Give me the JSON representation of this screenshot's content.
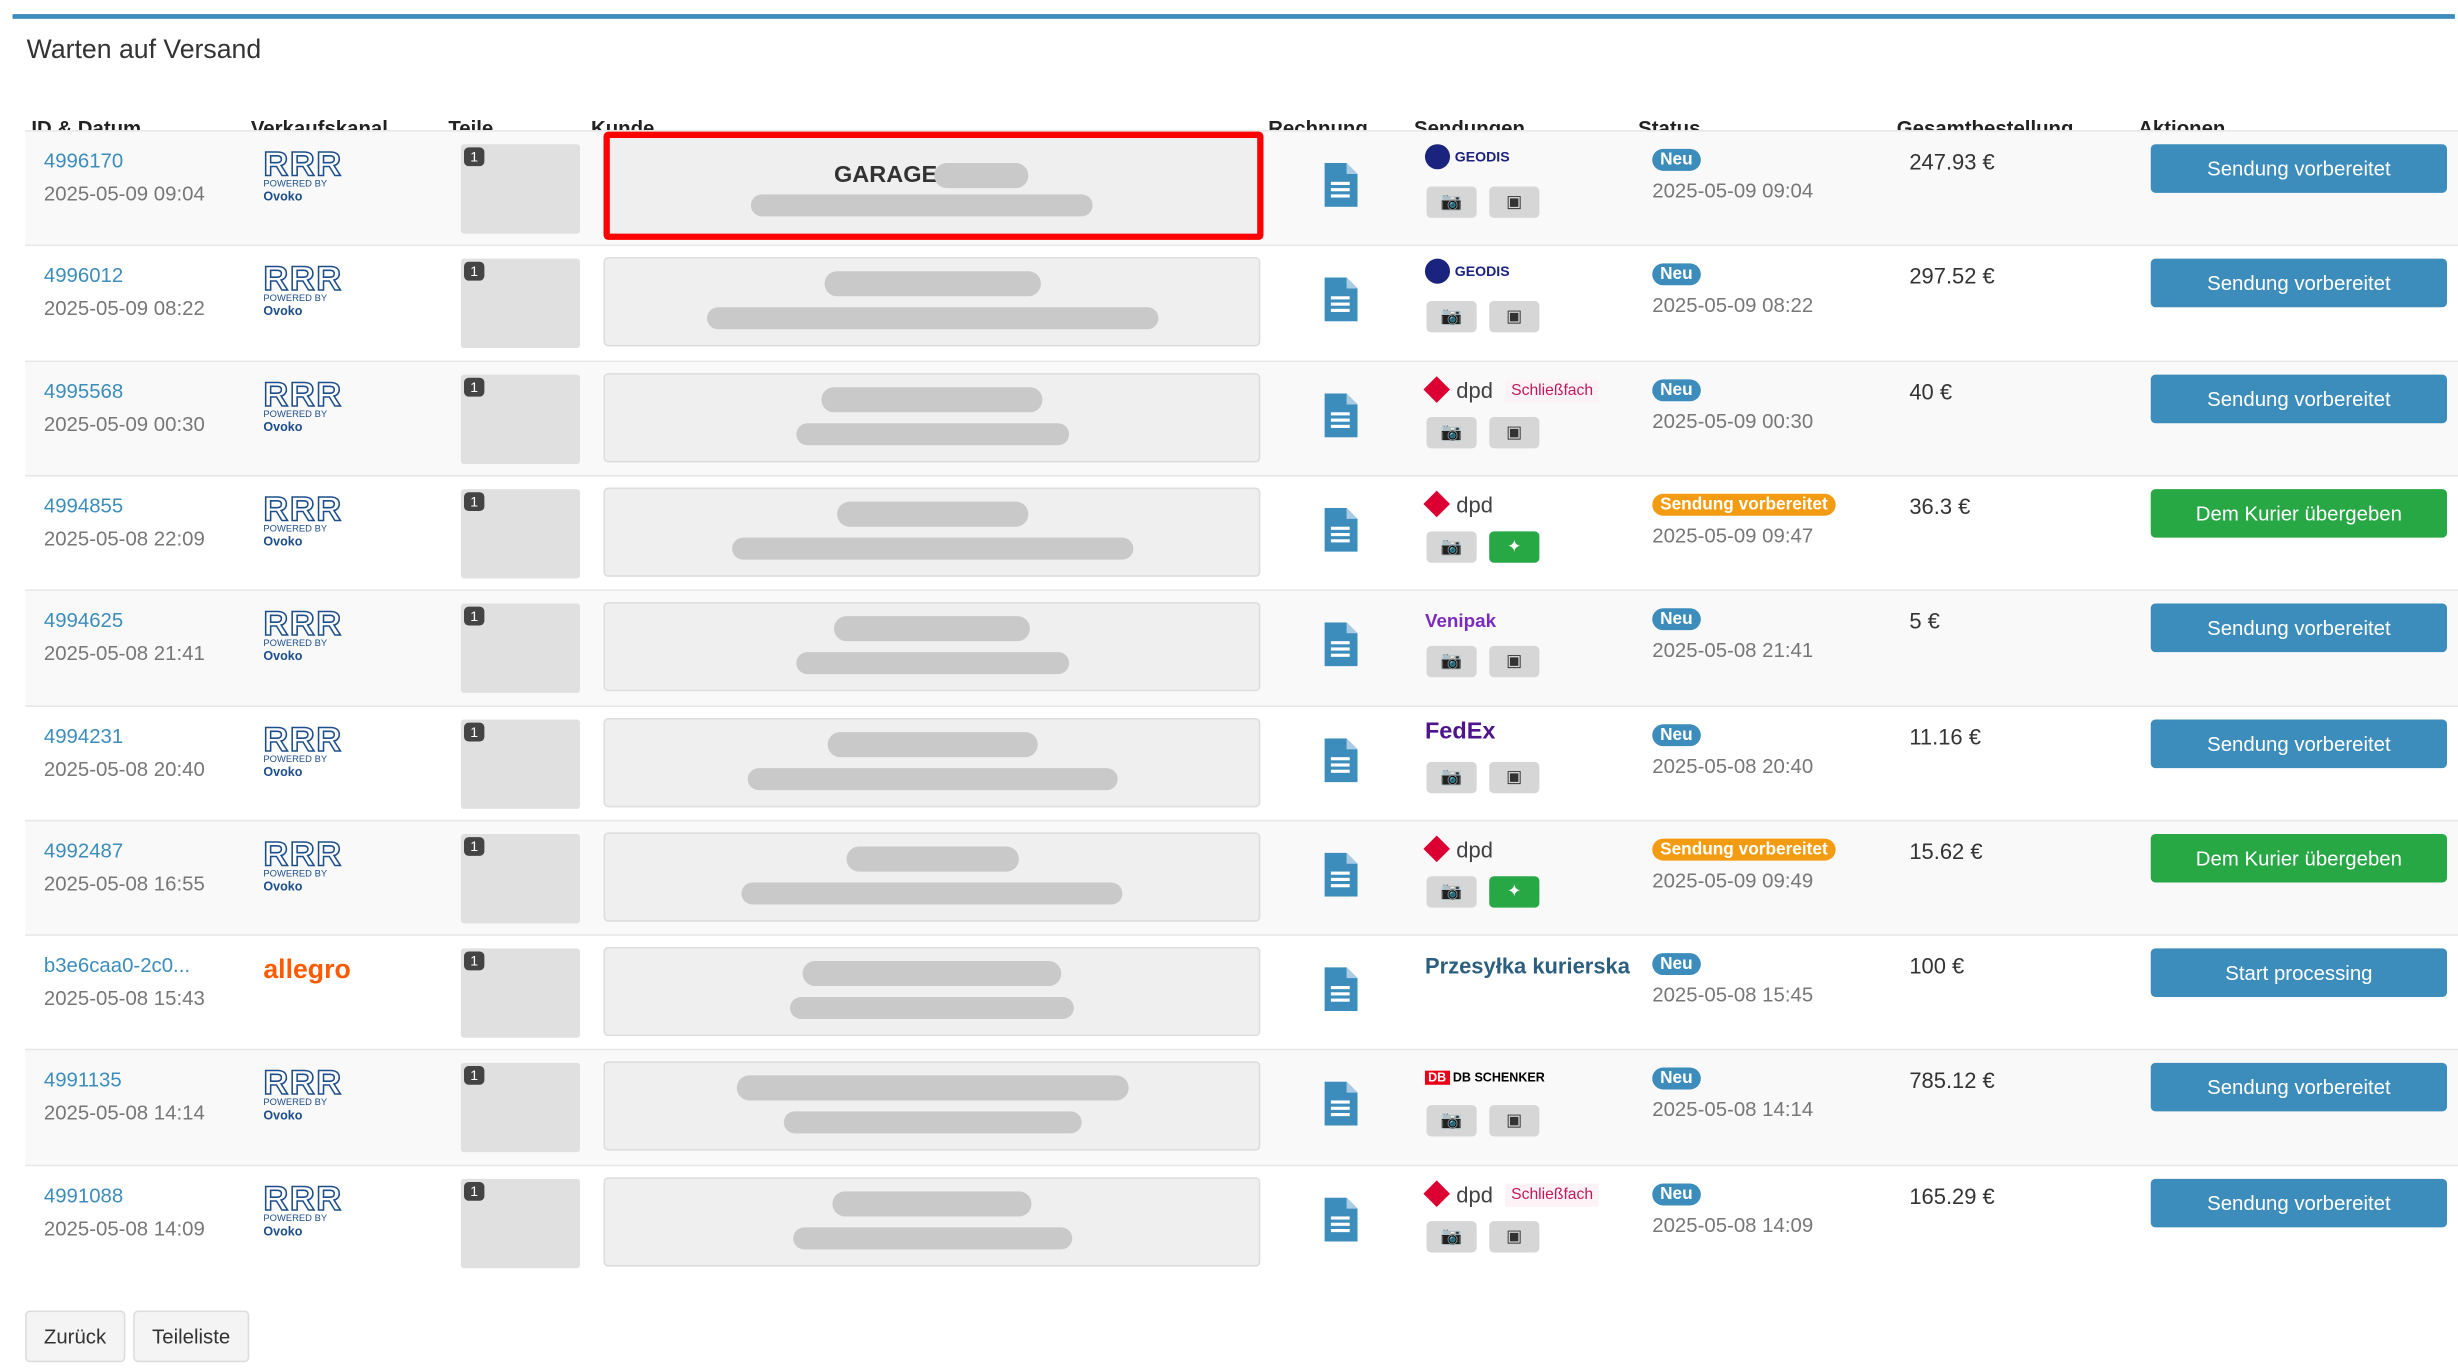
{
  "panel": {
    "title": "Warten auf Versand"
  },
  "headers": {
    "id_date": "ID & Datum",
    "channel": "Verkaufskanal",
    "parts": "Teile",
    "customer": "Kunde",
    "invoice": "Rechnung",
    "shipments": "Sendungen",
    "status": "Status",
    "total": "Gesamtbestellung",
    "actions": "Aktionen"
  },
  "rows": [
    {
      "id": "4996170",
      "date": "2025-05-09 09:04",
      "channel": "RRR",
      "qty": "1",
      "customer": "GARAGE",
      "carrier": "GEODIS",
      "carrier_tag": "",
      "status": "Neu",
      "status_date": "2025-05-09 09:04",
      "total": "247.93 €",
      "action": "Sendung vorbereitet",
      "action_color": "#3c8dbc"
    },
    {
      "id": "4996012",
      "date": "2025-05-09 08:22",
      "channel": "RRR",
      "qty": "1",
      "customer": "",
      "carrier": "GEODIS",
      "carrier_tag": "",
      "status": "Neu",
      "status_date": "2025-05-09 08:22",
      "total": "297.52 €",
      "action": "Sendung vorbereitet",
      "action_color": "#3c8dbc"
    },
    {
      "id": "4995568",
      "date": "2025-05-09 00:30",
      "channel": "RRR",
      "qty": "1",
      "customer": "",
      "carrier": "dpd",
      "carrier_tag": "Schließfach",
      "status": "Neu",
      "status_date": "2025-05-09 00:30",
      "total": "40 €",
      "action": "Sendung vorbereitet",
      "action_color": "#3c8dbc"
    },
    {
      "id": "4994855",
      "date": "2025-05-08 22:09",
      "channel": "RRR",
      "qty": "1",
      "customer": "",
      "carrier": "dpd",
      "carrier_tag": "",
      "status": "Sendung vorbereitet",
      "status_date": "2025-05-09 09:47",
      "total": "36.3 €",
      "action": "Dem Kurier übergeben",
      "action_color": "#28a745"
    },
    {
      "id": "4994625",
      "date": "2025-05-08 21:41",
      "channel": "RRR",
      "qty": "1",
      "customer": "",
      "carrier": "Venipak",
      "carrier_tag": "",
      "status": "Neu",
      "status_date": "2025-05-08 21:41",
      "total": "5 €",
      "action": "Sendung vorbereitet",
      "action_color": "#3c8dbc"
    },
    {
      "id": "4994231",
      "date": "2025-05-08 20:40",
      "channel": "RRR",
      "qty": "1",
      "customer": "",
      "carrier": "FedEx",
      "carrier_tag": "",
      "status": "Neu",
      "status_date": "2025-05-08 20:40",
      "total": "11.16 €",
      "action": "Sendung vorbereitet",
      "action_color": "#3c8dbc"
    },
    {
      "id": "4992487",
      "date": "2025-05-08 16:55",
      "channel": "RRR",
      "qty": "1",
      "customer": "",
      "carrier": "dpd",
      "carrier_tag": "",
      "status": "Sendung vorbereitet",
      "status_date": "2025-05-09 09:49",
      "total": "15.62 €",
      "action": "Dem Kurier übergeben",
      "action_color": "#28a745"
    },
    {
      "id": "b3e6caa0-2c0...",
      "date": "2025-05-08 15:43",
      "channel": "allegro",
      "qty": "1",
      "customer": "",
      "carrier": "Przesyłka kurierska",
      "carrier_tag": "",
      "status": "Neu",
      "status_date": "2025-05-08 15:45",
      "total": "100 €",
      "action": "Start processing",
      "action_color": "#3c8dbc"
    },
    {
      "id": "4991135",
      "date": "2025-05-08 14:14",
      "channel": "RRR",
      "qty": "1",
      "customer": "",
      "carrier": "DB SCHENKER",
      "carrier_tag": "",
      "status": "Neu",
      "status_date": "2025-05-08 14:14",
      "total": "785.12 €",
      "action": "Sendung vorbereitet",
      "action_color": "#3c8dbc"
    },
    {
      "id": "4991088",
      "date": "2025-05-08 14:09",
      "channel": "RRR",
      "qty": "1",
      "customer": "",
      "carrier": "dpd",
      "carrier_tag": "Schließfach",
      "status": "Neu",
      "status_date": "2025-05-08 14:09",
      "total": "165.29 €",
      "action": "Sendung vorbereitet",
      "action_color": "#3c8dbc"
    }
  ],
  "footer": {
    "back": "Zurück",
    "parts_list": "Teileliste"
  },
  "colors": {
    "accent": "#3c8dbc",
    "success": "#28a745",
    "warning": "#f39c12",
    "highlight": "#ff0000"
  }
}
